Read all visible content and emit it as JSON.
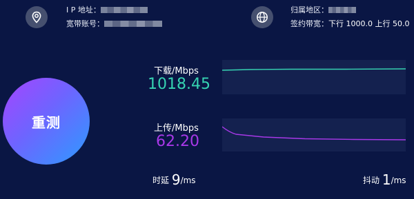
{
  "info": {
    "ip_label": "I P  地址：",
    "account_label": "宽带账号：",
    "region_label": "归属地区：",
    "bandwidth_label": "签约带宽：",
    "bandwidth_value": "下行 1000.0 上行 50.0",
    "location_icon": "location-pin-icon",
    "globe_icon": "globe-icon"
  },
  "retest": {
    "label": "重测"
  },
  "download": {
    "label": "下载/Mbps",
    "value": "1018.45",
    "color": "#36d3b2"
  },
  "upload": {
    "label": "上传/Mbps",
    "value": "62.20",
    "color": "#a838e8"
  },
  "latency": {
    "label": "时延",
    "value": "9",
    "unit": "/ms"
  },
  "jitter": {
    "label": "抖动",
    "value": "1",
    "unit": "/ms"
  },
  "colors": {
    "background": "#0a1644",
    "panel": "#14214f"
  }
}
